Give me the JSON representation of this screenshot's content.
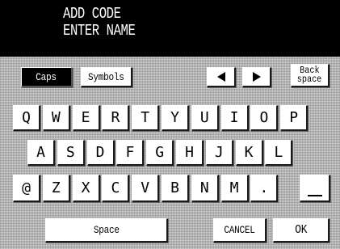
{
  "header": {
    "line1": "ADD CODE",
    "line2": "ENTER NAME"
  },
  "toolbar": {
    "caps_label": "Caps",
    "symbols_label": "Symbols",
    "back_line1": "Back",
    "back_line2": "space"
  },
  "keys": {
    "row1": [
      "Q",
      "W",
      "E",
      "R",
      "T",
      "Y",
      "U",
      "I",
      "O",
      "P"
    ],
    "row2": [
      "A",
      "S",
      "D",
      "F",
      "G",
      "H",
      "J",
      "K",
      "L"
    ],
    "row3": [
      "@",
      "Z",
      "X",
      "C",
      "V",
      "B",
      "N",
      "M",
      "."
    ]
  },
  "bottom": {
    "space_label": "Space",
    "cancel_label": "CANCEL",
    "ok_label": "OK"
  },
  "icons": {
    "cursor_left": "left-arrow-icon",
    "cursor_right": "right-arrow-icon",
    "underscore": "underscore-icon"
  },
  "colors": {
    "header_bg": "#000000",
    "header_text": "#ffffff",
    "panel_bg": "#b4b4b4",
    "key_bg": "#ffffff",
    "selected_key_bg": "#000000"
  }
}
